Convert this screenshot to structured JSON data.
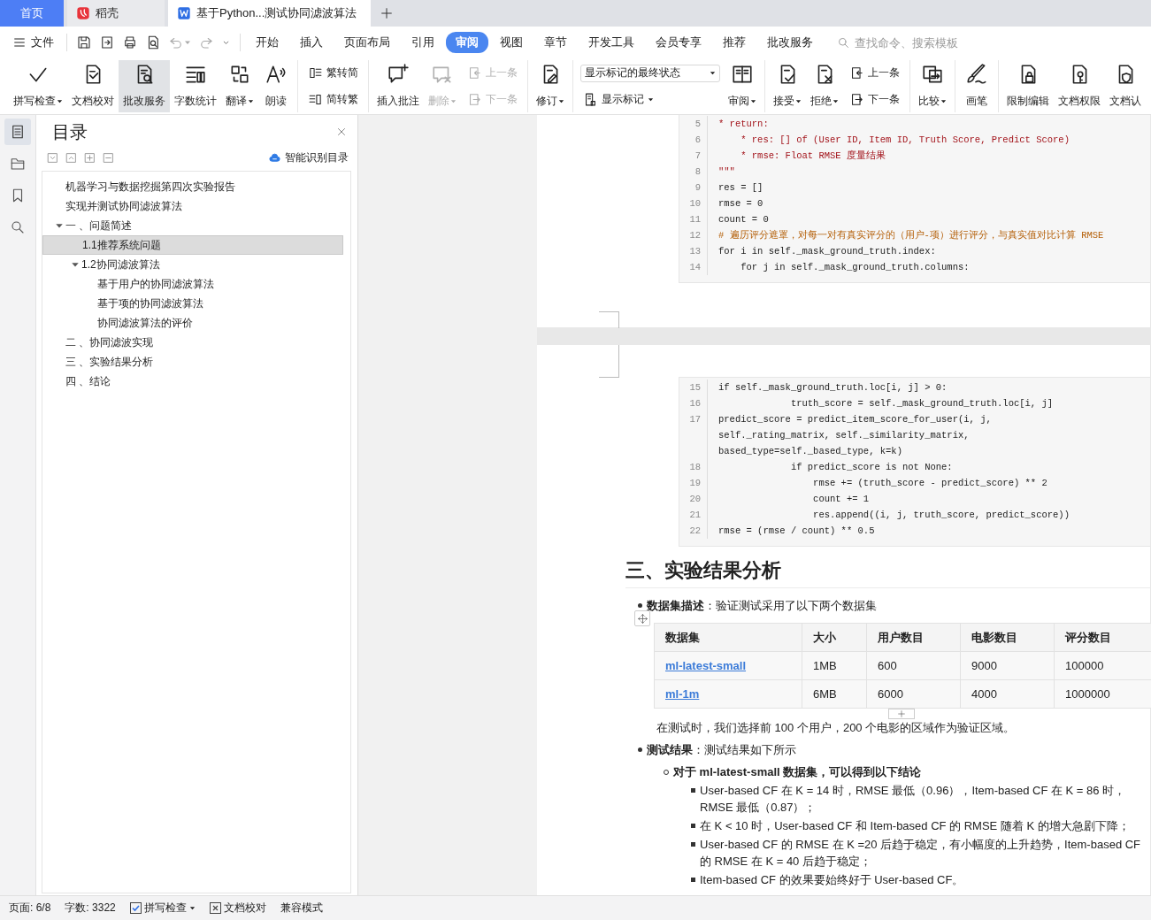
{
  "tabs": [
    {
      "label": "首页",
      "kind": "home",
      "selected": false
    },
    {
      "label": "稻壳",
      "kind": "docer",
      "selected": false
    },
    {
      "label": "基于Python...测试协同滤波算法",
      "kind": "doc",
      "selected": true
    }
  ],
  "menu": {
    "file": "文件",
    "quick": [
      {
        "disabled": false,
        "dropdown": false
      },
      {
        "disabled": false,
        "dropdown": false
      },
      {
        "disabled": false,
        "dropdown": false
      },
      {
        "disabled": false,
        "dropdown": false
      },
      {
        "disabled": true,
        "dropdown": true
      },
      {
        "disabled": true,
        "dropdown": false
      },
      {
        "disabled": false,
        "dropdown": false
      }
    ],
    "tabs": [
      {
        "label": "开始",
        "selected": false
      },
      {
        "label": "插入",
        "selected": false
      },
      {
        "label": "页面布局",
        "selected": false
      },
      {
        "label": "引用",
        "selected": false
      },
      {
        "label": "审阅",
        "selected": true
      },
      {
        "label": "视图",
        "selected": false
      },
      {
        "label": "章节",
        "selected": false
      },
      {
        "label": "开发工具",
        "selected": false
      },
      {
        "label": "会员专享",
        "selected": false
      },
      {
        "label": "推荐",
        "selected": false
      },
      {
        "label": "批改服务",
        "selected": false
      }
    ],
    "search": {
      "placeholder": "查找命令、搜索模板"
    }
  },
  "ribbon": {
    "groups": [
      {
        "items": [
          {
            "kind": "big",
            "label": "拼写检查",
            "dropdown": true,
            "selected": false,
            "disabled": false
          },
          {
            "kind": "big",
            "label": "文档校对",
            "dropdown": false,
            "selected": false,
            "disabled": false
          },
          {
            "kind": "big",
            "label": "批改服务",
            "dropdown": false,
            "selected": true,
            "disabled": false
          },
          {
            "kind": "big",
            "label": "字数统计",
            "dropdown": false,
            "selected": false,
            "disabled": false
          },
          {
            "kind": "big",
            "label": "翻译",
            "dropdown": true,
            "selected": false,
            "disabled": false
          },
          {
            "kind": "big",
            "label": "朗读",
            "dropdown": false,
            "selected": false,
            "disabled": false
          }
        ]
      },
      {
        "items": [
          {
            "kind": "stack",
            "buttons": [
              {
                "label": "繁转简",
                "disabled": false,
                "dropdown": false
              },
              {
                "label": "简转繁",
                "disabled": false,
                "dropdown": false
              }
            ]
          }
        ]
      },
      {
        "items": [
          {
            "kind": "big",
            "label": "插入批注",
            "dropdown": false,
            "selected": false,
            "disabled": false
          },
          {
            "kind": "big",
            "label": "删除",
            "dropdown": true,
            "selected": false,
            "disabled": true
          },
          {
            "kind": "stack",
            "buttons": [
              {
                "label": "上一条",
                "disabled": true,
                "dropdown": false
              },
              {
                "label": "下一条",
                "disabled": true,
                "dropdown": false
              }
            ]
          }
        ]
      },
      {
        "items": [
          {
            "kind": "big",
            "label": "修订",
            "dropdown": true,
            "selected": false,
            "disabled": false
          }
        ]
      },
      {
        "items": [
          {
            "kind": "select",
            "value": "显示标记的最终状态",
            "button": {
              "label": "显示标记",
              "dropdown": true,
              "disabled": false
            }
          },
          {
            "kind": "big",
            "label": "审阅",
            "dropdown": true,
            "selected": false,
            "disabled": false
          }
        ]
      },
      {
        "items": [
          {
            "kind": "big",
            "label": "接受",
            "dropdown": true,
            "selected": false,
            "disabled": false
          },
          {
            "kind": "big",
            "label": "拒绝",
            "dropdown": true,
            "selected": false,
            "disabled": false
          },
          {
            "kind": "stack",
            "buttons": [
              {
                "label": "上一条",
                "disabled": false,
                "dropdown": false
              },
              {
                "label": "下一条",
                "disabled": false,
                "dropdown": false
              }
            ]
          }
        ]
      },
      {
        "items": [
          {
            "kind": "big",
            "label": "比较",
            "dropdown": true,
            "selected": false,
            "disabled": false
          }
        ]
      },
      {
        "items": [
          {
            "kind": "big",
            "label": "画笔",
            "dropdown": false,
            "selected": false,
            "disabled": false
          }
        ]
      },
      {
        "items": [
          {
            "kind": "big",
            "label": "限制编辑",
            "dropdown": false,
            "selected": false,
            "disabled": false
          },
          {
            "kind": "big",
            "label": "文档权限",
            "dropdown": false,
            "selected": false,
            "disabled": false
          },
          {
            "kind": "big",
            "label": "文档认",
            "dropdown": false,
            "selected": false,
            "disabled": false
          }
        ]
      }
    ]
  },
  "rail": [
    {
      "selected": true
    },
    {
      "selected": false
    },
    {
      "selected": false
    },
    {
      "selected": false
    }
  ],
  "toc": {
    "title": "目录",
    "smart": "智能识别目录",
    "items": [
      {
        "label": "机器学习与数据挖掘第四次实验报告",
        "selected": false
      },
      {
        "label": "实现并测试协同滤波算法",
        "selected": false
      },
      {
        "label": "一 、问题简述",
        "selected": false,
        "expanded": true,
        "children": [
          {
            "label": "1.1推荐系统问题",
            "selected": true
          },
          {
            "label": "1.2协同滤波算法",
            "selected": false,
            "expanded": true,
            "children": [
              {
                "label": "基于用户的协同滤波算法",
                "selected": false
              },
              {
                "label": "基于项的协同滤波算法",
                "selected": false
              },
              {
                "label": "协同滤波算法的评价",
                "selected": false
              }
            ]
          }
        ]
      },
      {
        "label": "二 、协同滤波实现",
        "selected": false
      },
      {
        "label": "三 、实验结果分析",
        "selected": false
      },
      {
        "label": "四 、结论",
        "selected": false
      }
    ]
  },
  "document": {
    "page_1": {
      "code_lines": [
        {
          "n": "5",
          "kind": "doc",
          "text": "* return:"
        },
        {
          "n": "6",
          "kind": "doc",
          "text": "    * res: [] of (User ID, Item ID, Truth Score, Predict Score)"
        },
        {
          "n": "7",
          "kind": "doc",
          "text": "    * rmse: Float RMSE 度量结果"
        },
        {
          "n": "8",
          "kind": "doc",
          "text": "\"\"\""
        },
        {
          "n": "9",
          "kind": "code",
          "text": "res = []"
        },
        {
          "n": "10",
          "kind": "code",
          "text": "rmse = 0"
        },
        {
          "n": "11",
          "kind": "code",
          "text": "count = 0"
        },
        {
          "n": "12",
          "kind": "comment",
          "text": "# 遍历评分遮罩，对每一对有真实评分的（用户-项）进行评分，与真实值对比计算 RMSE"
        },
        {
          "n": "13",
          "kind": "code",
          "text": "for i in self._mask_ground_truth.index:"
        },
        {
          "n": "14",
          "kind": "code",
          "text": "    for j in self._mask_ground_truth.columns:"
        }
      ]
    },
    "page_2": {
      "code_lines": [
        {
          "n": "15",
          "kind": "code",
          "text": "if self._mask_ground_truth.loc[i, j] > 0:"
        },
        {
          "n": "16",
          "kind": "code",
          "text": "             truth_score = self._mask_ground_truth.loc[i, j]"
        },
        {
          "n": "17",
          "kind": "code",
          "text": "predict_score = predict_item_score_for_user(i, j,"
        },
        {
          "kind": "code",
          "text": "self._rating_matrix, self._similarity_matrix,"
        },
        {
          "kind": "code",
          "text": "based_type=self._based_type, k=k)"
        },
        {
          "n": "18",
          "kind": "code",
          "text": "             if predict_score is not None:"
        },
        {
          "n": "19",
          "kind": "code",
          "text": "                 rmse += (truth_score - predict_score) ** 2"
        },
        {
          "n": "20",
          "kind": "code",
          "text": "                 count += 1"
        },
        {
          "n": "21",
          "kind": "code",
          "text": "                 res.append((i, j, truth_score, predict_score))"
        },
        {
          "n": "22",
          "kind": "code",
          "text": "rmse = (rmse / count) ** 0.5"
        }
      ],
      "heading": "三、实验结果分析",
      "dataset": {
        "text": "**数据集描述**：验证测试采用了以下两个数据集",
        "table": {
          "columns": [
            "数据集",
            "大小",
            "用户数目",
            "电影数目",
            "评分数目"
          ],
          "rows": [
            [
              "ml-latest-small",
              "1MB",
              "600",
              "9000",
              "100000"
            ],
            [
              "ml-1m",
              "6MB",
              "6000",
              "4000",
              "1000000"
            ]
          ]
        },
        "note": "在测试时，我们选择前 100 个用户，200 个电影的区域作为验证区域。"
      },
      "results": {
        "text": "**测试结果**：测试结果如下所示",
        "children": [
          {
            "text": "对于 ml-latest-small 数据集，可以得到以下结论",
            "children": [
              {
                "text": "User-based CF 在 K = 14 时，RMSE 最低（0.96），Item-based CF 在 K = 86 时，RMSE 最低（0.87）；"
              },
              {
                "text": "在 K < 10 时，User-based CF 和 Item-based CF 的 RMSE 随着 K 的增大急剧下降；"
              },
              {
                "text": "User-based CF 的 RMSE 在 K =20 后趋于稳定，有小幅度的上升趋势，Item-based CF 的 RMSE 在 K = 40 后趋于稳定；"
              },
              {
                "text": "Item-based CF 的效果要始终好于 User-based CF。"
              }
            ]
          }
        ]
      }
    }
  },
  "status": [
    {
      "kind": "text",
      "label": "页面: 6/8"
    },
    {
      "kind": "text",
      "label": "字数: 3322"
    },
    {
      "kind": "check",
      "label": "拼写检查",
      "checked": true,
      "dropdown": true
    },
    {
      "kind": "check",
      "label": "文档校对",
      "checked": false,
      "dropdown": false
    },
    {
      "kind": "text",
      "label": "兼容模式"
    }
  ]
}
